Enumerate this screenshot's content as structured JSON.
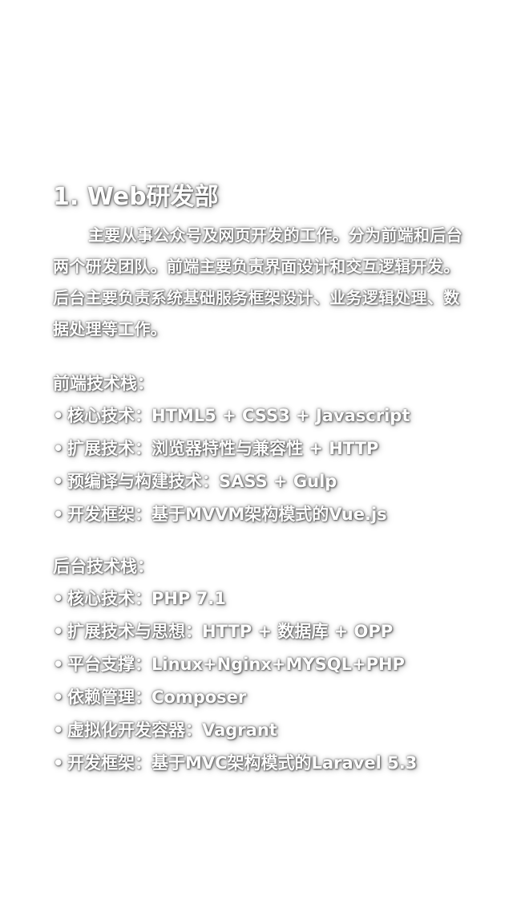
{
  "section": {
    "title": "1. Web研发部",
    "description": "主要从事公众号及网页开发的工作。分为前端和后台两个研发团队。前端主要负责界面设计和交互逻辑开发。后台主要负责系统基础服务框架设计、业务逻辑处理、数据处理等工作。"
  },
  "frontend": {
    "heading": "前端技术栈：",
    "bullet": "•",
    "items": [
      "核心技术：HTML5 + CSS3 + Javascript",
      "扩展技术：浏览器特性与兼容性 + HTTP",
      "预编译与构建技术：SASS + Gulp",
      "开发框架：基于MVVM架构模式的Vue.js"
    ]
  },
  "backend": {
    "heading": "后台技术栈：",
    "bullet": "•",
    "items": [
      "核心技术：PHP 7.1",
      "扩展技术与思想：HTTP + 数据库 + OPP",
      "平台支撑：Linux+Nginx+MYSQL+PHP",
      "依赖管理：Composer",
      "虚拟化开发容器：Vagrant",
      "开发框架：基于MVC架构模式的Laravel 5.3"
    ]
  },
  "colors": {
    "background": "#ffffff",
    "text": "#ffffff",
    "shadow": "#000000"
  }
}
